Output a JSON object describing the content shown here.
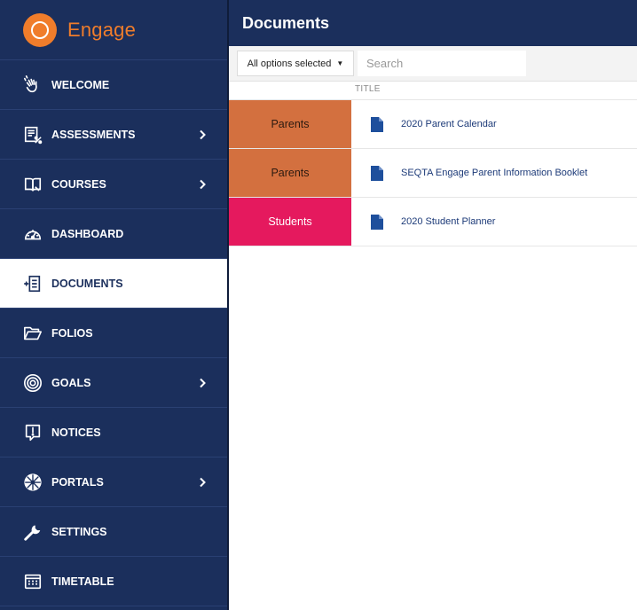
{
  "app": {
    "name": "Engage",
    "brand_color": "#f07d2b",
    "nav_bg": "#1b2f5c"
  },
  "sidebar": {
    "items": [
      {
        "label": "WELCOME",
        "icon": "hand-wave-icon",
        "has_submenu": false,
        "active": false
      },
      {
        "label": "ASSESSMENTS",
        "icon": "assessment-percent-icon",
        "has_submenu": true,
        "active": false
      },
      {
        "label": "COURSES",
        "icon": "book-open-icon",
        "has_submenu": true,
        "active": false
      },
      {
        "label": "DASHBOARD",
        "icon": "gauge-icon",
        "has_submenu": false,
        "active": false
      },
      {
        "label": "DOCUMENTS",
        "icon": "document-list-icon",
        "has_submenu": false,
        "active": true
      },
      {
        "label": "FOLIOS",
        "icon": "folder-open-icon",
        "has_submenu": false,
        "active": false
      },
      {
        "label": "GOALS",
        "icon": "target-icon",
        "has_submenu": true,
        "active": false
      },
      {
        "label": "NOTICES",
        "icon": "notice-exclamation-icon",
        "has_submenu": false,
        "active": false
      },
      {
        "label": "PORTALS",
        "icon": "portal-swirl-icon",
        "has_submenu": true,
        "active": false
      },
      {
        "label": "SETTINGS",
        "icon": "wrench-icon",
        "has_submenu": false,
        "active": false
      },
      {
        "label": "TIMETABLE",
        "icon": "timetable-grid-icon",
        "has_submenu": false,
        "active": false
      }
    ]
  },
  "header": {
    "title": "Documents"
  },
  "toolbar": {
    "filter_label": "All options selected",
    "search_placeholder": "Search"
  },
  "table": {
    "column_title": "TITLE",
    "rows": [
      {
        "category": "Parents",
        "category_color": "#d3703f",
        "title": "2020 Parent Calendar"
      },
      {
        "category": "Parents",
        "category_color": "#d3703f",
        "title": "SEQTA Engage Parent Information Booklet"
      },
      {
        "category": "Students",
        "category_color": "#e5195e",
        "title": "2020 Student Planner"
      }
    ]
  }
}
